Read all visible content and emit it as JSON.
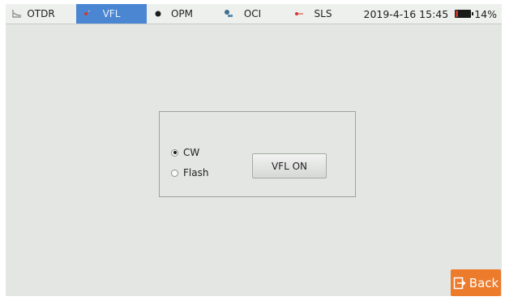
{
  "tabs": [
    {
      "label": "OTDR",
      "icon": "otdr-trace-icon",
      "active": false
    },
    {
      "label": "VFL",
      "icon": "vfl-laser-icon",
      "active": true
    },
    {
      "label": "OPM",
      "icon": "opm-meter-icon",
      "active": false
    },
    {
      "label": "OCI",
      "icon": "oci-microscope-icon",
      "active": false
    },
    {
      "label": "SLS",
      "icon": "sls-source-icon",
      "active": false
    }
  ],
  "status": {
    "datetime": "2019-4-16 15:45",
    "battery_percent_text": "14%",
    "battery_level": 0.14
  },
  "vfl_panel": {
    "modes": [
      {
        "label": "CW",
        "selected": true
      },
      {
        "label": "Flash",
        "selected": false
      }
    ],
    "toggle_label": "VFL ON"
  },
  "back_button": {
    "label": "Back",
    "icon": "exit-icon"
  },
  "colors": {
    "active_tab": "#4a86d2",
    "back_button": "#ec7b2c",
    "background": "#e3e6e2",
    "laser_red": "#d9342b"
  }
}
